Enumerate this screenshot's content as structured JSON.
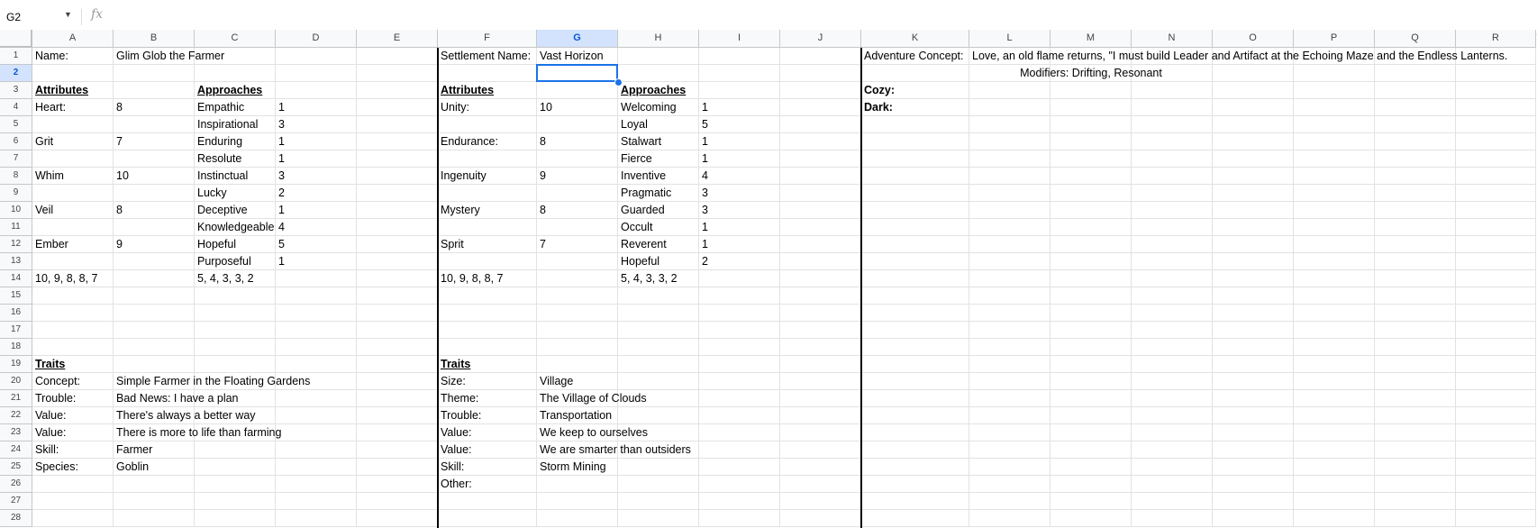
{
  "formula_bar": {
    "name_box": "G2",
    "fx": "fx",
    "formula": ""
  },
  "columns": [
    "A",
    "B",
    "C",
    "D",
    "E",
    "F",
    "G",
    "H",
    "I",
    "J",
    "K",
    "L",
    "M",
    "N",
    "O",
    "P",
    "Q",
    "R"
  ],
  "rows": [
    "1",
    "2",
    "3",
    "4",
    "5",
    "6",
    "7",
    "8",
    "9",
    "10",
    "11",
    "12",
    "13",
    "14",
    "15",
    "16",
    "17",
    "18",
    "19",
    "20",
    "21",
    "22",
    "23",
    "24",
    "25",
    "26",
    "27",
    "28"
  ],
  "selected": {
    "column": "G",
    "row": "2"
  },
  "cells": [
    {
      "r": 1,
      "c": "A",
      "v": "Name:"
    },
    {
      "r": 1,
      "c": "B",
      "v": "Glim Glob the Farmer"
    },
    {
      "r": 1,
      "c": "F",
      "v": "Settlement Name:"
    },
    {
      "r": 1,
      "c": "G",
      "v": "Vast Horizon"
    },
    {
      "r": 1,
      "c": "K",
      "v": "Adventure Concept:"
    },
    {
      "r": 1,
      "c": "L",
      "v": "Love, an old flame returns, \"I must build Leader and Artifact at the Echoing Maze and the Endless Lanterns."
    },
    {
      "r": 2,
      "c": "M",
      "v": "Modifiers: Drifting, Resonant",
      "style": "center-span"
    },
    {
      "r": 3,
      "c": "A",
      "v": "Attributes",
      "style": "boldul"
    },
    {
      "r": 3,
      "c": "C",
      "v": "Approaches",
      "style": "boldul"
    },
    {
      "r": 3,
      "c": "F",
      "v": "Attributes",
      "style": "boldul"
    },
    {
      "r": 3,
      "c": "H",
      "v": "Approaches",
      "style": "boldul"
    },
    {
      "r": 3,
      "c": "K",
      "v": "Cozy:",
      "style": "bold"
    },
    {
      "r": 4,
      "c": "A",
      "v": "Heart:"
    },
    {
      "r": 4,
      "c": "B",
      "v": "8"
    },
    {
      "r": 4,
      "c": "C",
      "v": "Empathic"
    },
    {
      "r": 4,
      "c": "D",
      "v": "1"
    },
    {
      "r": 4,
      "c": "F",
      "v": "Unity:"
    },
    {
      "r": 4,
      "c": "G",
      "v": "10"
    },
    {
      "r": 4,
      "c": "H",
      "v": "Welcoming"
    },
    {
      "r": 4,
      "c": "I",
      "v": "1"
    },
    {
      "r": 4,
      "c": "K",
      "v": "Dark:",
      "style": "bold"
    },
    {
      "r": 5,
      "c": "C",
      "v": "Inspirational"
    },
    {
      "r": 5,
      "c": "D",
      "v": "3"
    },
    {
      "r": 5,
      "c": "H",
      "v": "Loyal"
    },
    {
      "r": 5,
      "c": "I",
      "v": "5"
    },
    {
      "r": 6,
      "c": "A",
      "v": "Grit"
    },
    {
      "r": 6,
      "c": "B",
      "v": "7"
    },
    {
      "r": 6,
      "c": "C",
      "v": "Enduring"
    },
    {
      "r": 6,
      "c": "D",
      "v": "1"
    },
    {
      "r": 6,
      "c": "F",
      "v": "Endurance:"
    },
    {
      "r": 6,
      "c": "G",
      "v": "8"
    },
    {
      "r": 6,
      "c": "H",
      "v": "Stalwart"
    },
    {
      "r": 6,
      "c": "I",
      "v": "1"
    },
    {
      "r": 7,
      "c": "C",
      "v": "Resolute"
    },
    {
      "r": 7,
      "c": "D",
      "v": "1"
    },
    {
      "r": 7,
      "c": "H",
      "v": "Fierce"
    },
    {
      "r": 7,
      "c": "I",
      "v": "1"
    },
    {
      "r": 8,
      "c": "A",
      "v": "Whim"
    },
    {
      "r": 8,
      "c": "B",
      "v": "10"
    },
    {
      "r": 8,
      "c": "C",
      "v": "Instinctual"
    },
    {
      "r": 8,
      "c": "D",
      "v": "3"
    },
    {
      "r": 8,
      "c": "F",
      "v": "Ingenuity"
    },
    {
      "r": 8,
      "c": "G",
      "v": "9"
    },
    {
      "r": 8,
      "c": "H",
      "v": "Inventive"
    },
    {
      "r": 8,
      "c": "I",
      "v": "4"
    },
    {
      "r": 9,
      "c": "C",
      "v": "Lucky"
    },
    {
      "r": 9,
      "c": "D",
      "v": "2"
    },
    {
      "r": 9,
      "c": "H",
      "v": "Pragmatic"
    },
    {
      "r": 9,
      "c": "I",
      "v": "3"
    },
    {
      "r": 10,
      "c": "A",
      "v": "Veil"
    },
    {
      "r": 10,
      "c": "B",
      "v": "8"
    },
    {
      "r": 10,
      "c": "C",
      "v": "Deceptive"
    },
    {
      "r": 10,
      "c": "D",
      "v": "1"
    },
    {
      "r": 10,
      "c": "F",
      "v": "Mystery"
    },
    {
      "r": 10,
      "c": "G",
      "v": "8"
    },
    {
      "r": 10,
      "c": "H",
      "v": "Guarded"
    },
    {
      "r": 10,
      "c": "I",
      "v": "3"
    },
    {
      "r": 11,
      "c": "C",
      "v": "Knowledgeable"
    },
    {
      "r": 11,
      "c": "D",
      "v": "4"
    },
    {
      "r": 11,
      "c": "H",
      "v": "Occult"
    },
    {
      "r": 11,
      "c": "I",
      "v": "1"
    },
    {
      "r": 12,
      "c": "A",
      "v": "Ember"
    },
    {
      "r": 12,
      "c": "B",
      "v": "9"
    },
    {
      "r": 12,
      "c": "C",
      "v": "Hopeful"
    },
    {
      "r": 12,
      "c": "D",
      "v": "5"
    },
    {
      "r": 12,
      "c": "F",
      "v": "Sprit"
    },
    {
      "r": 12,
      "c": "G",
      "v": "7"
    },
    {
      "r": 12,
      "c": "H",
      "v": "Reverent"
    },
    {
      "r": 12,
      "c": "I",
      "v": "1"
    },
    {
      "r": 13,
      "c": "C",
      "v": "Purposeful"
    },
    {
      "r": 13,
      "c": "D",
      "v": "1"
    },
    {
      "r": 13,
      "c": "H",
      "v": "Hopeful"
    },
    {
      "r": 13,
      "c": "I",
      "v": "2"
    },
    {
      "r": 14,
      "c": "A",
      "v": "10, 9, 8, 8, 7"
    },
    {
      "r": 14,
      "c": "C",
      "v": "5, 4, 3, 3, 2"
    },
    {
      "r": 14,
      "c": "F",
      "v": "10, 9, 8, 8, 7"
    },
    {
      "r": 14,
      "c": "H",
      "v": "5, 4, 3, 3, 2"
    },
    {
      "r": 19,
      "c": "A",
      "v": "Traits",
      "style": "boldul"
    },
    {
      "r": 19,
      "c": "F",
      "v": "Traits",
      "style": "boldul"
    },
    {
      "r": 20,
      "c": "A",
      "v": "Concept:"
    },
    {
      "r": 20,
      "c": "B",
      "v": "Simple Farmer in the Floating Gardens"
    },
    {
      "r": 20,
      "c": "F",
      "v": "Size:"
    },
    {
      "r": 20,
      "c": "G",
      "v": "Village"
    },
    {
      "r": 21,
      "c": "A",
      "v": "Trouble:"
    },
    {
      "r": 21,
      "c": "B",
      "v": "Bad News: I have a plan"
    },
    {
      "r": 21,
      "c": "F",
      "v": "Theme:"
    },
    {
      "r": 21,
      "c": "G",
      "v": "The Village of Clouds"
    },
    {
      "r": 22,
      "c": "A",
      "v": "Value:"
    },
    {
      "r": 22,
      "c": "B",
      "v": "There's always a better way"
    },
    {
      "r": 22,
      "c": "F",
      "v": "Trouble:"
    },
    {
      "r": 22,
      "c": "G",
      "v": "Transportation"
    },
    {
      "r": 23,
      "c": "A",
      "v": "Value:"
    },
    {
      "r": 23,
      "c": "B",
      "v": "There is more to life than farming"
    },
    {
      "r": 23,
      "c": "F",
      "v": "Value:"
    },
    {
      "r": 23,
      "c": "G",
      "v": "We keep to ourselves"
    },
    {
      "r": 24,
      "c": "A",
      "v": "Skill:"
    },
    {
      "r": 24,
      "c": "B",
      "v": "Farmer"
    },
    {
      "r": 24,
      "c": "F",
      "v": "Value:"
    },
    {
      "r": 24,
      "c": "G",
      "v": "We are smarter than outsiders"
    },
    {
      "r": 25,
      "c": "A",
      "v": "Species:"
    },
    {
      "r": 25,
      "c": "B",
      "v": "Goblin"
    },
    {
      "r": 25,
      "c": "F",
      "v": "Skill:"
    },
    {
      "r": 25,
      "c": "G",
      "v": "Storm Mining"
    },
    {
      "r": 26,
      "c": "F",
      "v": "Other:"
    }
  ]
}
